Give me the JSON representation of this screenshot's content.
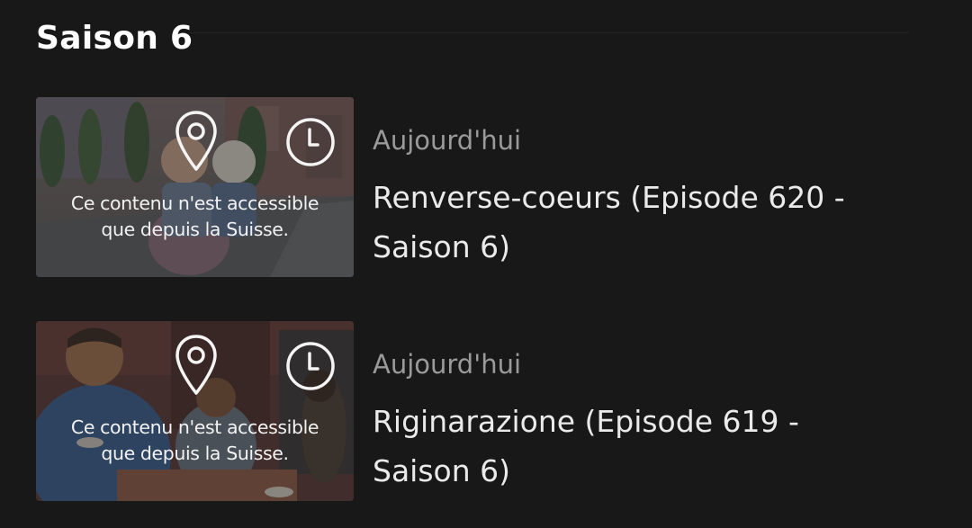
{
  "season": {
    "title": "Saison 6"
  },
  "episodes": [
    {
      "date": "Aujourd'hui",
      "title": "Renverse-coeurs (Episode 620 - Saison 6)",
      "notice_line1": "Ce contenu n'est accessible",
      "notice_line2": "que depuis la Suisse.",
      "icons": [
        "location-pin-icon",
        "clock-icon"
      ]
    },
    {
      "date": "Aujourd'hui",
      "title": "Riginarazione (Episode 619 - Saison 6)",
      "notice_line1": "Ce contenu n'est accessible",
      "notice_line2": "que depuis la Suisse.",
      "icons": [
        "location-pin-icon",
        "clock-icon"
      ]
    }
  ],
  "colors": {
    "background": "#181818",
    "date_text": "#9a9a9a",
    "title_text": "#eaeaea"
  }
}
